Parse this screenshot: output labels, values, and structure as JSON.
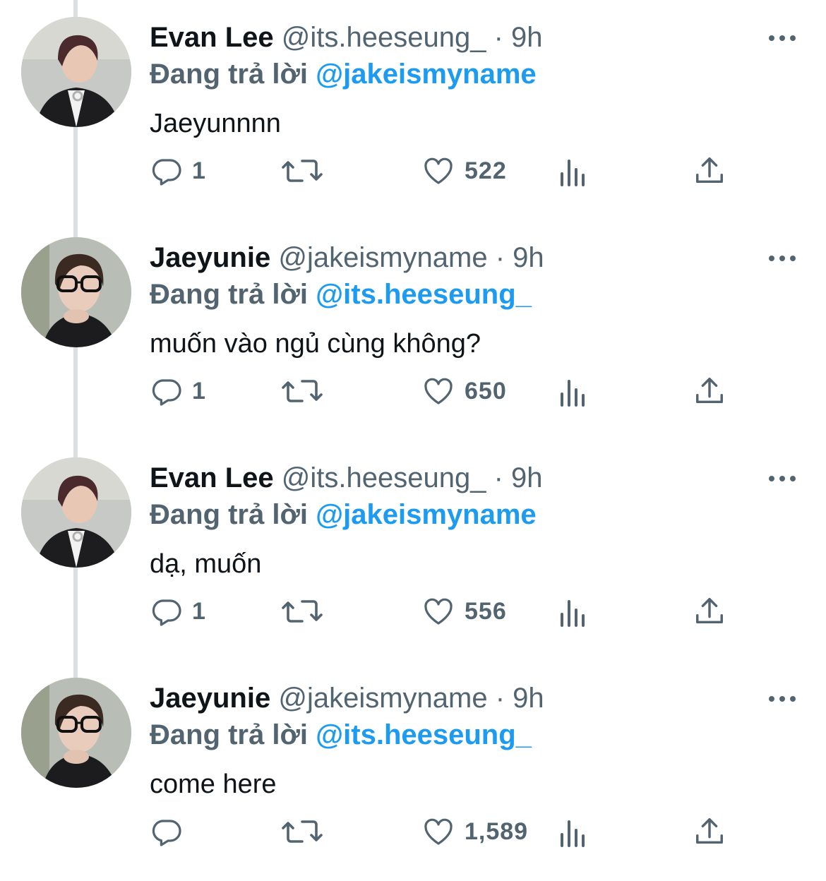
{
  "colors": {
    "name": "#0f1419",
    "secondary": "#536471",
    "accent": "#1d9bf0",
    "thread_line": "#dcdfe2"
  },
  "tweets": [
    {
      "name": "Evan Lee",
      "handle": "@its.heeseung_",
      "dot": "·",
      "time": "9h",
      "reply_prefix": "Đang trả lời",
      "reply_to": "@jakeismyname",
      "text": "Jaeyunnnn",
      "replies": "1",
      "likes": "522",
      "avatar_icon": "avatar-evan-lee"
    },
    {
      "name": "Jaeyunie",
      "handle": "@jakeismyname",
      "dot": "·",
      "time": "9h",
      "reply_prefix": "Đang trả lời",
      "reply_to": "@its.heeseung_",
      "text": "muốn vào ngủ cùng không?",
      "replies": "1",
      "likes": "650",
      "avatar_icon": "avatar-jaeyunie"
    },
    {
      "name": "Evan Lee",
      "handle": "@its.heeseung_",
      "dot": "·",
      "time": "9h",
      "reply_prefix": "Đang trả lời",
      "reply_to": "@jakeismyname",
      "text": "dạ, muốn",
      "replies": "1",
      "likes": "556",
      "avatar_icon": "avatar-evan-lee"
    },
    {
      "name": "Jaeyunie",
      "handle": "@jakeismyname",
      "dot": "·",
      "time": "9h",
      "reply_prefix": "Đang trả lời",
      "reply_to": "@its.heeseung_",
      "text": "come here",
      "replies": "",
      "likes": "1,589",
      "avatar_icon": "avatar-jaeyunie"
    }
  ]
}
